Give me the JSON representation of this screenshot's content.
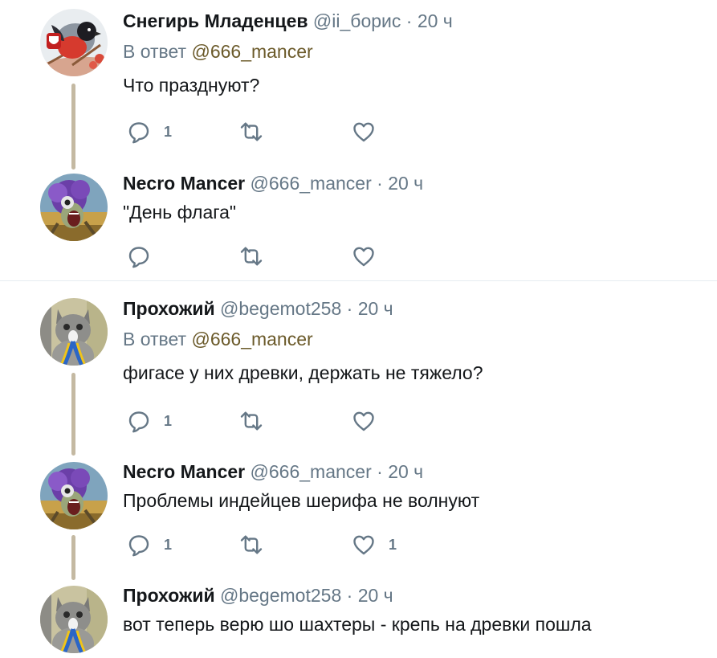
{
  "colors": {
    "name": "#14171a",
    "secondary": "#657786",
    "mention": "#6b5a2a",
    "thread_line": "#c4b9a2",
    "separator": "#e6ecf0"
  },
  "tweets": [
    {
      "name": "Снегирь Младенцев",
      "handle": "@ii_борис",
      "dot": "·",
      "time": "20 ч",
      "reply_prefix": "В ответ",
      "reply_mention": "@666_mancer",
      "text": "Что празднуют?",
      "avatar": "bullfinch-avatar",
      "reply_count": "1",
      "retweet_count": "",
      "like_count": ""
    },
    {
      "name": "Necro Mancer",
      "handle": "@666_mancer",
      "dot": "·",
      "time": "20 ч",
      "text": "\"День флага\"",
      "avatar": "purple-creature-avatar",
      "reply_count": "",
      "retweet_count": "",
      "like_count": ""
    },
    {
      "name": "Прохожий",
      "handle": "@begemot258",
      "dot": "·",
      "time": "20 ч",
      "reply_prefix": "В ответ",
      "reply_mention": "@666_mancer",
      "text": "фигасе у них древки, держать не тяжело?",
      "avatar": "cat-avatar",
      "reply_count": "1",
      "retweet_count": "",
      "like_count": ""
    },
    {
      "name": "Necro Mancer",
      "handle": "@666_mancer",
      "dot": "·",
      "time": "20 ч",
      "text": "Проблемы индейцев шерифа не волнуют",
      "avatar": "purple-creature-avatar",
      "reply_count": "1",
      "retweet_count": "",
      "like_count": "1"
    },
    {
      "name": "Прохожий",
      "handle": "@begemot258",
      "dot": "·",
      "time": "20 ч",
      "text": "вот теперь верю шо шахтеры - крепь на древки пошла",
      "avatar": "cat-avatar"
    }
  ],
  "icons": {
    "reply": "reply-icon",
    "retweet": "retweet-icon",
    "like": "like-icon"
  }
}
